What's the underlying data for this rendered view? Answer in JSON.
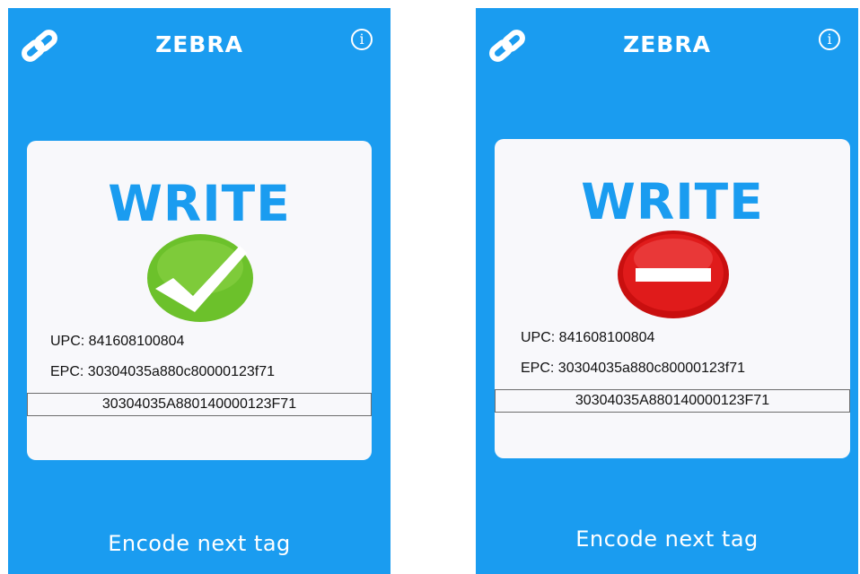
{
  "screens": [
    {
      "app_title": "ZEBRA",
      "heading": "WRITE",
      "status": "success",
      "status_icon": "checkmark-icon",
      "upc_text": "UPC: 841608100804",
      "epc_text": "EPC: 30304035a880c80000123f71",
      "encoded_value": "30304035A880140000123F71",
      "action_label": "Encode next tag"
    },
    {
      "app_title": "ZEBRA",
      "heading": "WRITE",
      "status": "failure",
      "status_icon": "no-entry-icon",
      "upc_text": "UPC: 841608100804",
      "epc_text": "EPC: 30304035a880c80000123f71",
      "encoded_value": "30304035A880140000123F71",
      "action_label": "Encode next tag"
    }
  ],
  "info_icon_glyph": "i",
  "colors": {
    "background": "#1a9cf0",
    "card": "#f8f8fb",
    "heading": "#1a9cf0",
    "success": "#6cc12b",
    "failure": "#e01b1b"
  }
}
